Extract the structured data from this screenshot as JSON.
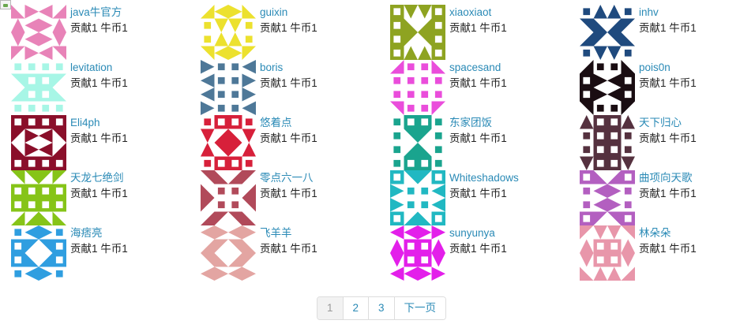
{
  "members": [
    {
      "name": "java牛官方",
      "contribution": "贡献1",
      "coins": "牛币1",
      "color": "#e883b8"
    },
    {
      "name": "guixin",
      "contribution": "贡献1",
      "coins": "牛币1",
      "color": "#ece12e"
    },
    {
      "name": "xiaoxiaot",
      "contribution": "贡献1",
      "coins": "牛币1",
      "color": "#8ea321"
    },
    {
      "name": "inhv",
      "contribution": "贡献1",
      "coins": "牛币1",
      "color": "#1f4a7e"
    },
    {
      "name": "levitation",
      "contribution": "贡献1",
      "coins": "牛币1",
      "color": "#a7f6e6"
    },
    {
      "name": "boris",
      "contribution": "贡献1",
      "coins": "牛币1",
      "color": "#4e7898"
    },
    {
      "name": "spacesand",
      "contribution": "贡献1",
      "coins": "牛币1",
      "color": "#ea4ddb"
    },
    {
      "name": "pois0n",
      "contribution": "贡献1",
      "coins": "牛币1",
      "color": "#1a0d12"
    },
    {
      "name": "Eli4ph",
      "contribution": "贡献1",
      "coins": "牛币1",
      "color": "#8a0f2a"
    },
    {
      "name": "悠着点",
      "contribution": "贡献1",
      "coins": "牛币1",
      "color": "#d7203a"
    },
    {
      "name": "东家团饭",
      "contribution": "贡献1",
      "coins": "牛币1",
      "color": "#1aa48e"
    },
    {
      "name": "天下归心",
      "contribution": "贡献1",
      "coins": "牛币1",
      "color": "#55313f"
    },
    {
      "name": "天龙七绝剑",
      "contribution": "贡献1",
      "coins": "牛币1",
      "color": "#86c418"
    },
    {
      "name": "零点六一八",
      "contribution": "贡献1",
      "coins": "牛币1",
      "color": "#b14a5a"
    },
    {
      "name": "Whiteshadows",
      "contribution": "贡献1",
      "coins": "牛币1",
      "color": "#21b8c2"
    },
    {
      "name": "曲项向天歌",
      "contribution": "贡献1",
      "coins": "牛币1",
      "color": "#b35fc0"
    },
    {
      "name": "海痞亮",
      "contribution": "贡献1",
      "coins": "牛币1",
      "color": "#2f9ee0"
    },
    {
      "name": "飞羊羊",
      "contribution": "贡献1",
      "coins": "牛币1",
      "color": "#e3a5a2"
    },
    {
      "name": "sunyunya",
      "contribution": "贡献1",
      "coins": "牛币1",
      "color": "#e31fea"
    },
    {
      "name": "林朵朵",
      "contribution": "贡献1",
      "coins": "牛币1",
      "color": "#e896aa"
    }
  ],
  "pagination": {
    "current": "1",
    "pages": [
      "1",
      "2",
      "3"
    ],
    "next_label": "下一页"
  }
}
